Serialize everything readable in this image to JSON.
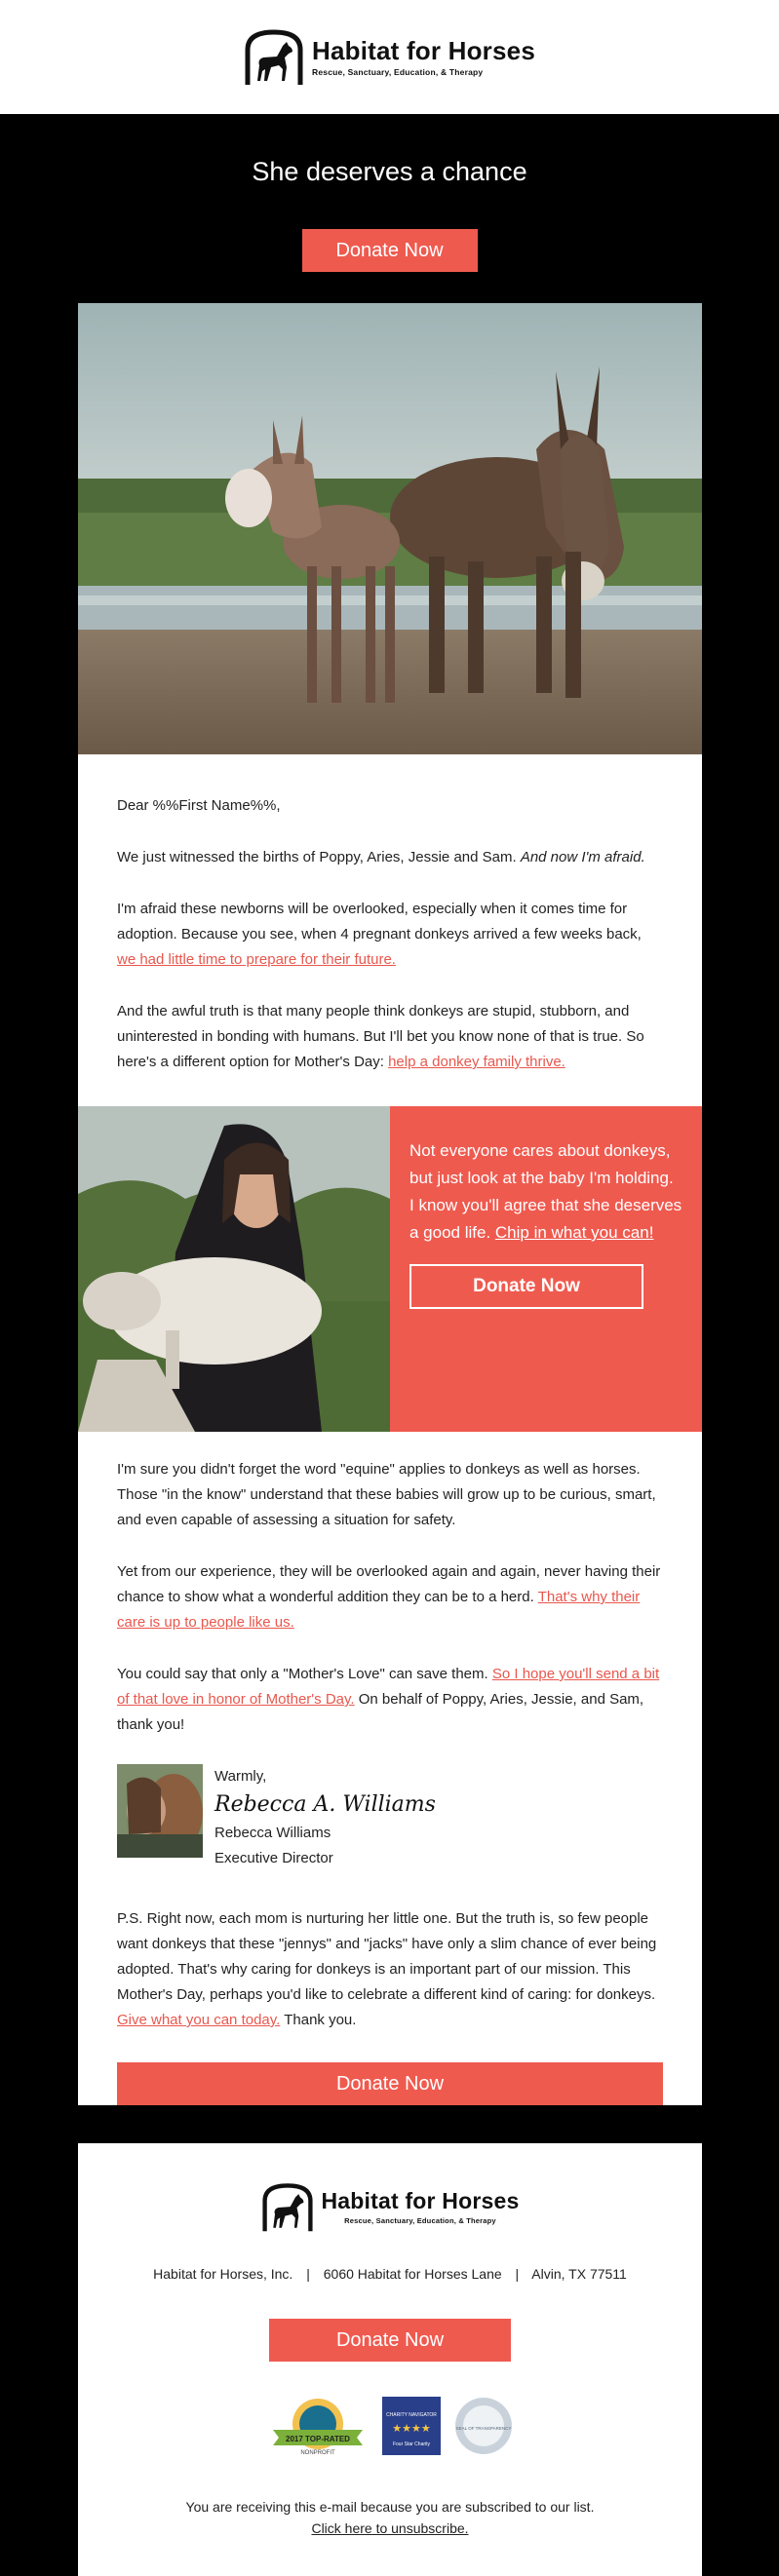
{
  "brand": {
    "name": "Habitat for Horses",
    "tagline": "Rescue, Sanctuary, Education, & Therapy"
  },
  "hero": {
    "title": "She deserves a chance",
    "donate_label": "Donate Now"
  },
  "letter": {
    "greeting": "Dear %%First Name%%,",
    "p1_text": "We just witnessed the births of Poppy, Aries, Jessie and Sam. ",
    "p1_emphasis": "And now I'm afraid.",
    "p2_text": "I'm afraid these newborns will be overlooked, especially when it comes time for adoption. Because you see, when 4 pregnant donkeys arrived a few weeks back, ",
    "p2_link": "we had little time to prepare for their future.",
    "p3_text": "And the awful truth is that many people think donkeys are stupid, stubborn, and uninterested in bonding with humans. But I'll bet you know none of that is true. So here's a different option for Mother's Day: ",
    "p3_link": "help a donkey family thrive."
  },
  "callout": {
    "text": "Not everyone cares about donkeys, but just look at the baby I'm holding. I know you'll agree that she deserves a good life. ",
    "link": "Chip in what you can!",
    "button_label": "Donate Now"
  },
  "letter2": {
    "p4": "I'm sure you didn't forget the word \"equine\" applies to donkeys as well as horses. Those \"in the know\" understand that these babies will grow up to be curious, smart, and even capable of assessing a situation for safety.",
    "p5_text": "Yet from our experience, they will be overlooked again and again, never having their chance to show what a wonderful addition they can be to a herd. ",
    "p5_link": "That's why their care is up to people like us.",
    "p6_text": "You could say that only a \"Mother's Love\" can save them. ",
    "p6_link": "So I hope you'll send a bit of that love in honor of Mother's Day.",
    "p6_tail": " On behalf of Poppy, Aries, Jessie, and Sam, thank you!"
  },
  "signature": {
    "closing": "Warmly,",
    "script": "Rebecca A. Williams",
    "name": "Rebecca Williams",
    "title": "Executive Director"
  },
  "ps": {
    "text": "P.S. Right now, each mom is nurturing her little one. But the truth is, so few people want donkeys that these \"jennys\" and \"jacks\" have only a slim chance of ever being adopted. That's why caring for donkeys is an important part of our mission. This Mother's Day, perhaps you'd like to celebrate a different kind of caring: for donkeys. ",
    "link": "Give what you can today.",
    "tail": " Thank you.",
    "button_label": "Donate Now"
  },
  "footer": {
    "org": "Habitat for Horses, Inc.",
    "address": "6060 Habitat for Horses Lane",
    "city": "Alvin, TX 77511",
    "separator": "|",
    "donate_label": "Donate Now",
    "subscribed_text": "You are receiving this e-mail because you are subscribed to our list.",
    "unsubscribe_link": "Click here to unsubscribe.",
    "badges": [
      {
        "icon": "guidestar-rosette-badge-icon",
        "text": "2017 TOP-RATED",
        "subtext": "NONPROFIT"
      },
      {
        "icon": "charity-navigator-badge-icon",
        "text": "CHARITY NAVIGATOR",
        "subtext": "Four Star Charity"
      },
      {
        "icon": "transparency-seal-badge-icon",
        "text": "SEAL OF TRANSPARENCY"
      }
    ]
  },
  "colors": {
    "accent": "#ef5a4f",
    "background": "#000000",
    "card": "#ffffff"
  }
}
